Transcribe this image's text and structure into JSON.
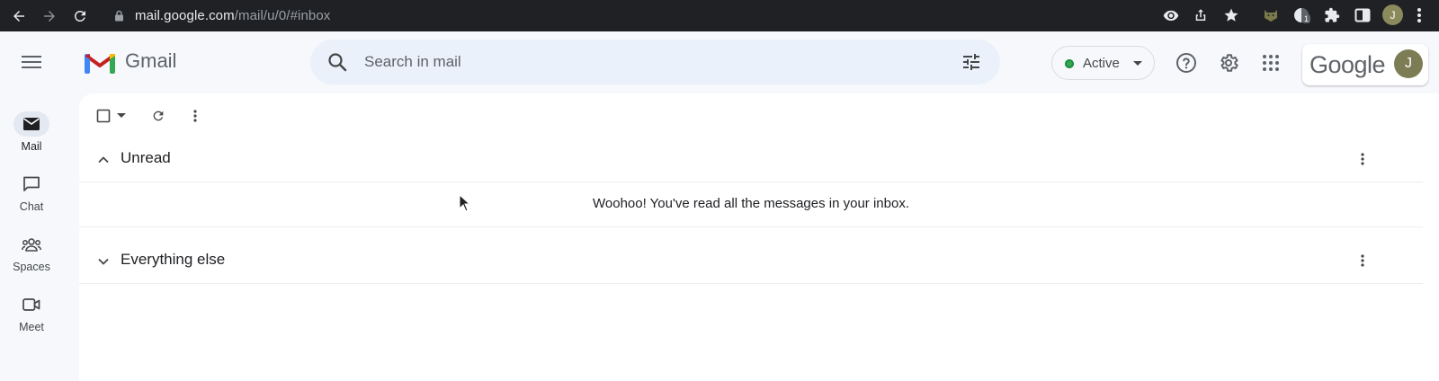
{
  "browser": {
    "url_host": "mail.google.com",
    "url_path": "/mail/u/0/#inbox",
    "profile_initial": "J",
    "extension_badge": "1"
  },
  "header": {
    "app_name": "Gmail",
    "search_placeholder": "Search in mail",
    "status_label": "Active",
    "google_wordmark": "Google",
    "account_initial": "J"
  },
  "rail": {
    "items": [
      {
        "label": "Mail",
        "icon": "mail-icon",
        "active": true
      },
      {
        "label": "Chat",
        "icon": "chat-icon",
        "active": false
      },
      {
        "label": "Spaces",
        "icon": "spaces-icon",
        "active": false
      },
      {
        "label": "Meet",
        "icon": "meet-icon",
        "active": false
      }
    ]
  },
  "inbox": {
    "sections": [
      {
        "title": "Unread",
        "expanded": true,
        "empty_message": "Woohoo! You've read all the messages in your inbox."
      },
      {
        "title": "Everything else",
        "expanded": false
      }
    ]
  },
  "colors": {
    "status_green": "#34a853",
    "search_bg": "#eaf1fb",
    "page_bg": "#f6f8fc"
  }
}
